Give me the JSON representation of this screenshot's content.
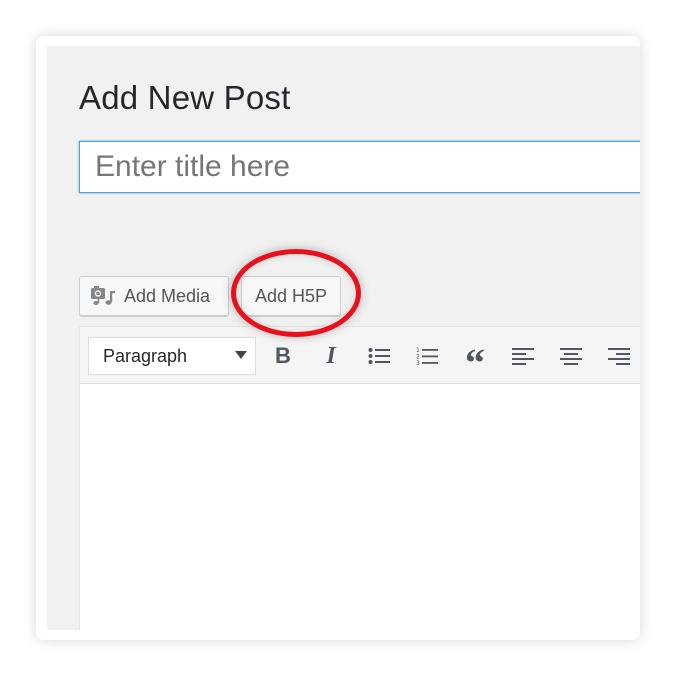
{
  "page": {
    "title": "Add New Post",
    "title_placeholder": "Enter title here"
  },
  "media_buttons": {
    "add_media_label": "Add Media",
    "add_h5p_label": "Add H5P"
  },
  "toolbar": {
    "format_selected": "Paragraph",
    "bold_glyph": "B",
    "italic_glyph": "I",
    "quote_glyph": "“",
    "icons": [
      "bold-icon",
      "italic-icon",
      "bullet-list-icon",
      "numbered-list-icon",
      "blockquote-icon",
      "align-left-icon",
      "align-center-icon",
      "align-right-icon"
    ]
  },
  "colors": {
    "highlight_ring": "#e8101b",
    "focus_border": "#5b9dd9",
    "background": "#f1f1f1"
  }
}
